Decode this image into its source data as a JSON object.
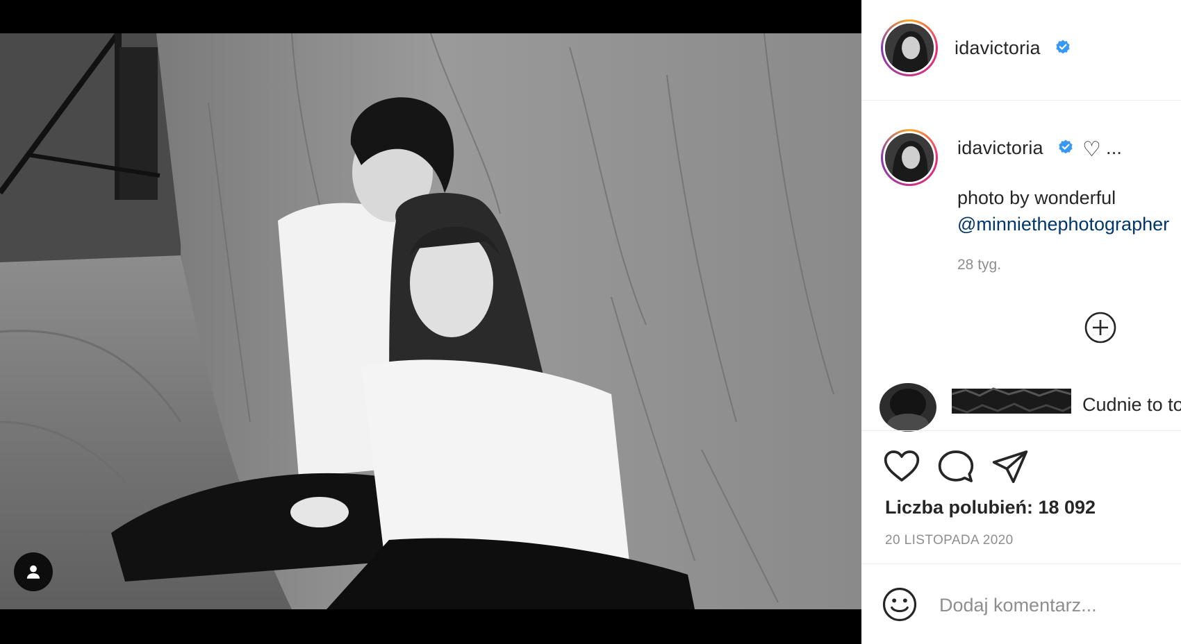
{
  "post": {
    "photo_alt": "",
    "tag_icon": "user-tag-icon"
  },
  "header": {
    "username": "idavictoria",
    "verified_icon": "verified-badge-icon"
  },
  "caption": {
    "username": "idavictoria",
    "heart_text": "♡",
    "ellipsis": "...",
    "text": "photo by wonderful",
    "mention": "@minniethephotographer",
    "time": "28 tyg."
  },
  "comments": {
    "load_more_icon": "plus-circle-icon",
    "items": [
      {
        "username_redacted": true,
        "text": "Cudnie to to"
      }
    ]
  },
  "actions": {
    "like_icon": "heart-icon",
    "comment_icon": "comment-bubble-icon",
    "share_icon": "paper-plane-icon",
    "likes_label": "Liczba polubień: 18 092",
    "date": "20 LISTOPADA 2020"
  },
  "comment_box": {
    "emoji_icon": "smiley-icon",
    "placeholder": "Dodaj komentarz..."
  },
  "colors": {
    "verified": "#3897f0",
    "mention": "#00376b",
    "muted": "#8e8e8e",
    "text": "#262626"
  }
}
